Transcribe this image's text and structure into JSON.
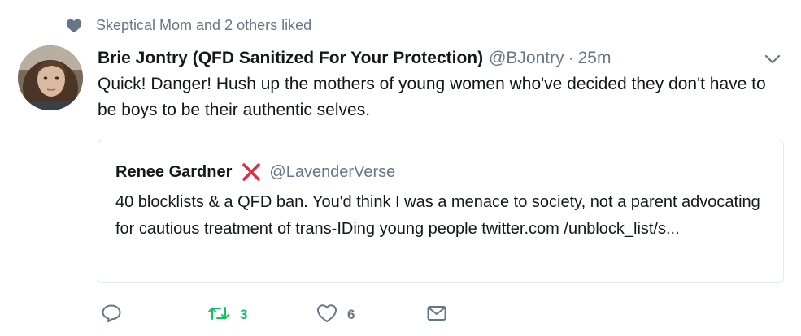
{
  "social_context": {
    "text": "Skeptical Mom and 2 others liked",
    "icon": "heart-icon"
  },
  "tweet": {
    "author_name": "Brie Jontry (QFD Sanitized For Your Protection)",
    "author_handle": "@BJontry",
    "separator": "·",
    "time": "25m",
    "text": "Quick! Danger! Hush up the mothers of young women who've decided they don't have to be boys to be their authentic selves."
  },
  "quoted_tweet": {
    "author_name": "Renee Gardner",
    "name_emoji": "❌",
    "author_handle": "@LavenderVerse",
    "text": "40 blocklists & a QFD ban. You'd think I was a menace to society, not a parent advocating for cautious treatment of trans-IDing young people twitter.com /unblock_list/s..."
  },
  "actions": {
    "reply_count": "",
    "retweet_count": "3",
    "like_count": "6"
  },
  "colors": {
    "secondary_text": "#657786",
    "retweet_active": "#17bf63",
    "x_mark": "#e0245e",
    "border": "#e1e8ed"
  }
}
